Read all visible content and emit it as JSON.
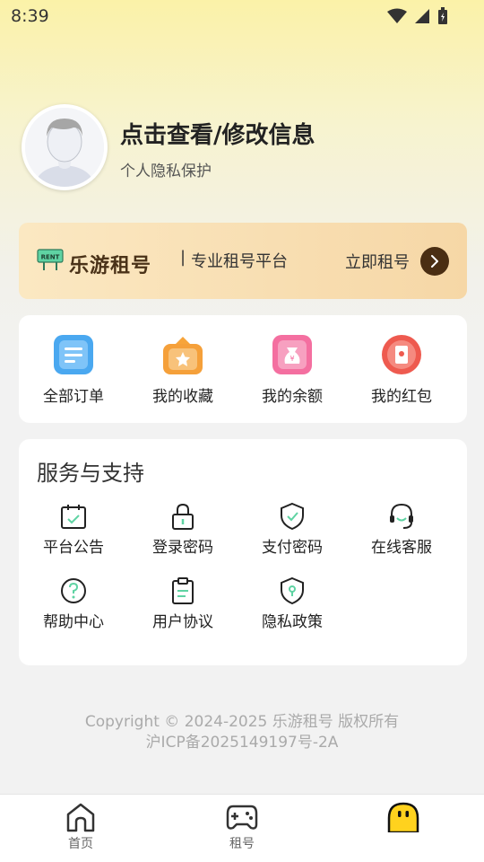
{
  "status_bar": {
    "time": "8:39"
  },
  "profile": {
    "name": "点击查看/修改信息",
    "subtitle": "个人隐私保护"
  },
  "banner": {
    "brand": "乐游租号",
    "separator": "|",
    "slogan": "专业租号平台",
    "cta": "立即租号",
    "logo_sign_text": "RENT"
  },
  "orders": [
    {
      "label": "全部订单",
      "icon": "order-list-icon"
    },
    {
      "label": "我的收藏",
      "icon": "favorites-icon"
    },
    {
      "label": "我的余额",
      "icon": "balance-icon"
    },
    {
      "label": "我的红包",
      "icon": "red-packet-icon"
    }
  ],
  "services": {
    "title": "服务与支持",
    "items": [
      {
        "label": "平台公告",
        "icon": "calendar-icon"
      },
      {
        "label": "登录密码",
        "icon": "lock-icon"
      },
      {
        "label": "支付密码",
        "icon": "shield-check-icon"
      },
      {
        "label": "在线客服",
        "icon": "headset-icon"
      },
      {
        "label": "帮助中心",
        "icon": "help-icon"
      },
      {
        "label": "用户协议",
        "icon": "clipboard-icon"
      },
      {
        "label": "隐私政策",
        "icon": "privacy-shield-icon"
      }
    ]
  },
  "copyright": {
    "line1": "Copyright © 2024-2025 乐游租号 版权所有",
    "line2": "沪ICP备2025149197号-2A"
  },
  "nav": [
    {
      "label": "首页",
      "icon": "home-icon"
    },
    {
      "label": "租号",
      "icon": "gamepad-icon"
    },
    {
      "label": "",
      "icon": "smiley-icon"
    }
  ],
  "colors": {
    "accent": "#4a2e13",
    "mint": "#5fd3a3",
    "banner_start": "#fbe8c2",
    "banner_end": "#f6d7a6"
  }
}
